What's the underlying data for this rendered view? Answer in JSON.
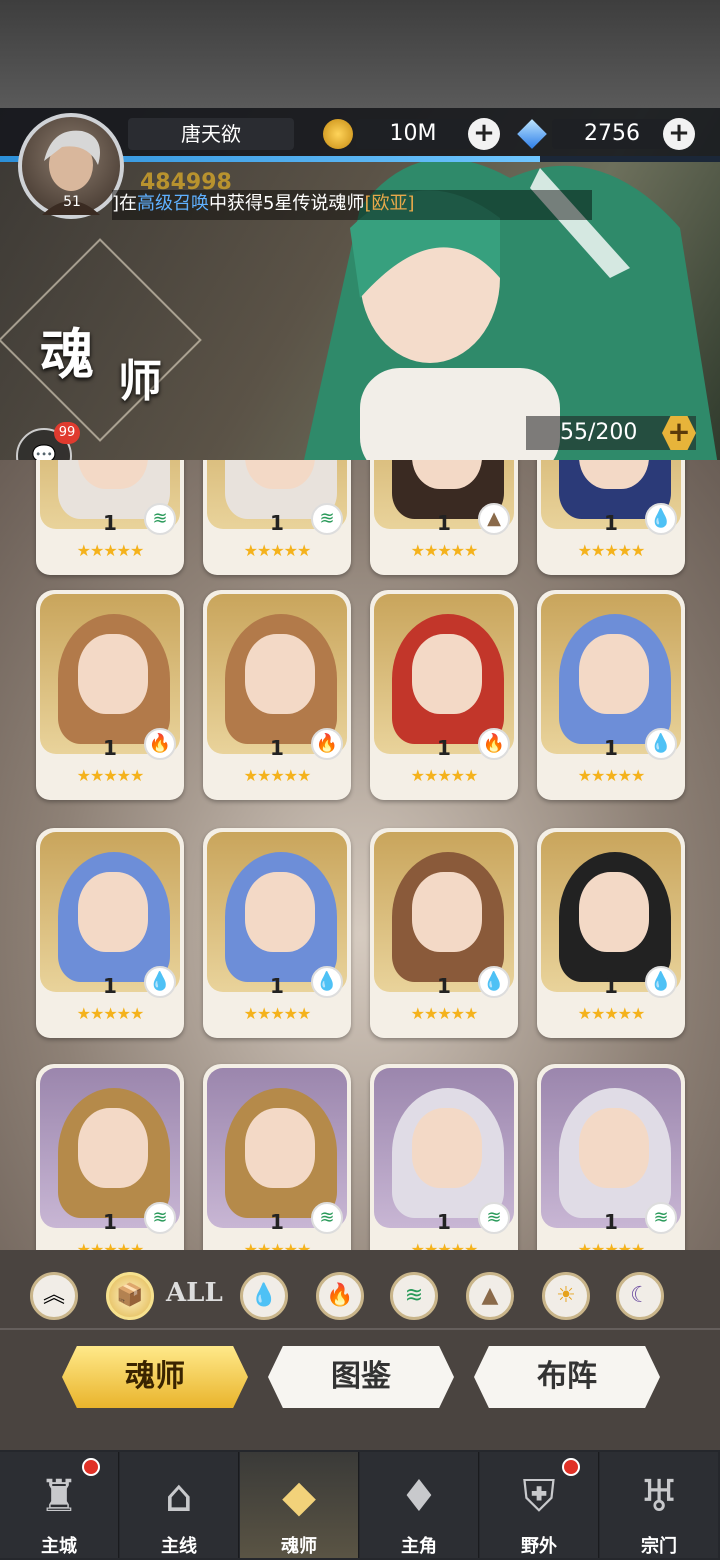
{
  "player": {
    "name": "唐天欲",
    "level": "51",
    "power": "484998"
  },
  "resources": {
    "gold": "10M",
    "gems": "2756"
  },
  "ticker": {
    "prefix": "]在",
    "highlight": "高级召唤",
    "middle": "中获得5星传说魂师",
    "hero": "[欧亚]"
  },
  "page": {
    "title_a": "魂",
    "title_b": "师",
    "capacity": "55/200"
  },
  "chat": {
    "badge": "99"
  },
  "filters": {
    "all_label": "ALL"
  },
  "tabs": [
    "魂师",
    "图鉴",
    "布阵"
  ],
  "nav": [
    "主城",
    "主线",
    "魂师",
    "主角",
    "野外",
    "宗门"
  ],
  "cards": [
    {
      "level": "1",
      "element": "wind",
      "stars": "★★★★★",
      "bg": "gold"
    },
    {
      "level": "1",
      "element": "wind",
      "stars": "★★★★★",
      "bg": "gold"
    },
    {
      "level": "1",
      "element": "earth",
      "stars": "★★★★★",
      "bg": "gold"
    },
    {
      "level": "1",
      "element": "water",
      "stars": "★★★★★",
      "bg": "gold"
    },
    {
      "level": "1",
      "element": "fire",
      "stars": "★★★★★",
      "bg": "gold"
    },
    {
      "level": "1",
      "element": "fire",
      "stars": "★★★★★",
      "bg": "gold"
    },
    {
      "level": "1",
      "element": "fire",
      "stars": "★★★★★",
      "bg": "gold"
    },
    {
      "level": "1",
      "element": "water",
      "stars": "★★★★★",
      "bg": "gold"
    },
    {
      "level": "1",
      "element": "water",
      "stars": "★★★★★",
      "bg": "gold"
    },
    {
      "level": "1",
      "element": "water",
      "stars": "★★★★★",
      "bg": "gold"
    },
    {
      "level": "1",
      "element": "water",
      "stars": "★★★★★",
      "bg": "gold"
    },
    {
      "level": "1",
      "element": "water",
      "stars": "★★★★★",
      "bg": "gold"
    },
    {
      "level": "1",
      "element": "wind",
      "stars": "★★★★★",
      "bg": "purple"
    },
    {
      "level": "1",
      "element": "wind",
      "stars": "★★★★★",
      "bg": "purple"
    },
    {
      "level": "1",
      "element": "wind",
      "stars": "★★★★★",
      "bg": "purple"
    },
    {
      "level": "1",
      "element": "wind",
      "stars": "★★★★★",
      "bg": "purple"
    }
  ]
}
